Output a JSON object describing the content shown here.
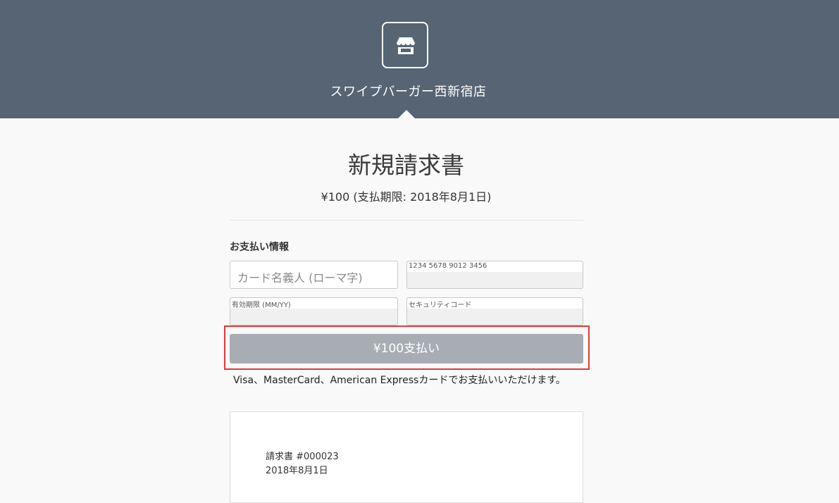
{
  "header": {
    "store_name": "スワイプバーガー西新宿店",
    "logo_icon": "store-icon",
    "background_color": "#566474"
  },
  "invoice": {
    "title": "新規請求書",
    "summary": "¥100 (支払期限: 2018年8月1日)",
    "number": "請求書 #000023",
    "date": "2018年8月1日"
  },
  "payment_form": {
    "section_label": "お支払い情報",
    "cardholder_placeholder": "カード名義人 (ローマ字)",
    "card_number_placeholder": "1234 5678 9012 3456",
    "expiry_placeholder": "有効期限 (MM/YY)",
    "security_code_placeholder": "セキュリティコード",
    "pay_button_label": "¥100支払い",
    "accepted_cards_note": "Visa、MasterCard、American Expressカードでお支払いいただけます。"
  },
  "colors": {
    "pay_button": "#a8adb4",
    "highlight": "#e53935"
  }
}
